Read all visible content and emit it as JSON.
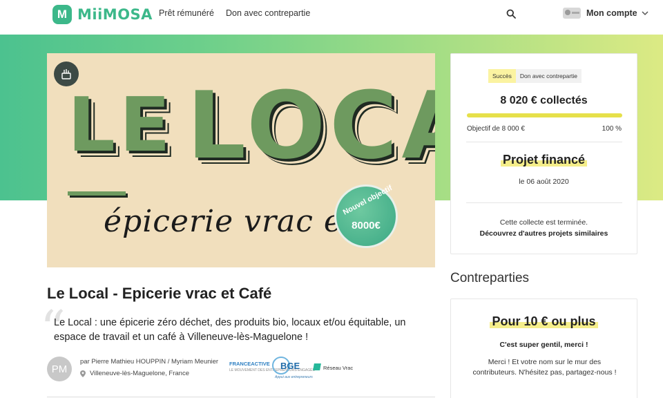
{
  "header": {
    "brand": "MiiMOSA",
    "logo_letter": "M",
    "nav": [
      "Prêt rémunéré",
      "Don avec contrepartie"
    ],
    "account_label": "Mon compte",
    "icons": [
      "search-icon",
      "chevron-down-icon"
    ]
  },
  "hero": {
    "image_title_le": "LE",
    "image_title": "LOCAL",
    "image_subtitle": "épicerie vrac et c",
    "sticker_top": "Nouvel objectif",
    "sticker_value": "8000€"
  },
  "project": {
    "title": "Le Local - Epicerie vrac et Café",
    "quote_glyph": "“",
    "description": "Le Local : une épicerie zéro déchet, des produits bio, locaux et/ou équitable, un espace de travail et un café à Villeneuve-lès-Maguelone !",
    "author_initials": "PM",
    "authors": "par Pierre Mathieu HOUPPIN / Myriam Meunier",
    "location": "Villeneuve-lès-Maguelone, France",
    "partners": {
      "france_active": "FRANCEACTIVE",
      "france_active_sub": "LE MOUVEMENT DES ENTREPRENEURS ENGAGÉS",
      "bge": "BGE",
      "bge_sub": "Appui aux entrepreneurs",
      "reseau_vrac": "Réseau Vrac"
    }
  },
  "funding": {
    "tag_status": "Succès",
    "tag_type": "Don avec contrepartie",
    "collected": "8 020 € collectés",
    "goal": "Objectif de 8 000 €",
    "percent_label": "100 %",
    "progress_fraction": 1.0,
    "funded_label": "Projet financé",
    "funded_date": "le 06 août 2020",
    "ended_text": "Cette collecte est terminée.",
    "discover_link": "Découvrez d'autres projets similaires"
  },
  "rewards": {
    "heading": "Contreparties",
    "items": [
      {
        "title": "Pour 10 € ou plus",
        "subtitle": "C'est super gentil, merci !",
        "description": "Merci ! Et votre nom sur le mur des contributeurs. N'hésitez pas, partagez-nous !"
      }
    ]
  },
  "colors": {
    "brand": "#3cb88a",
    "highlight": "#f5ee8a",
    "progress": "#e6e04a"
  }
}
